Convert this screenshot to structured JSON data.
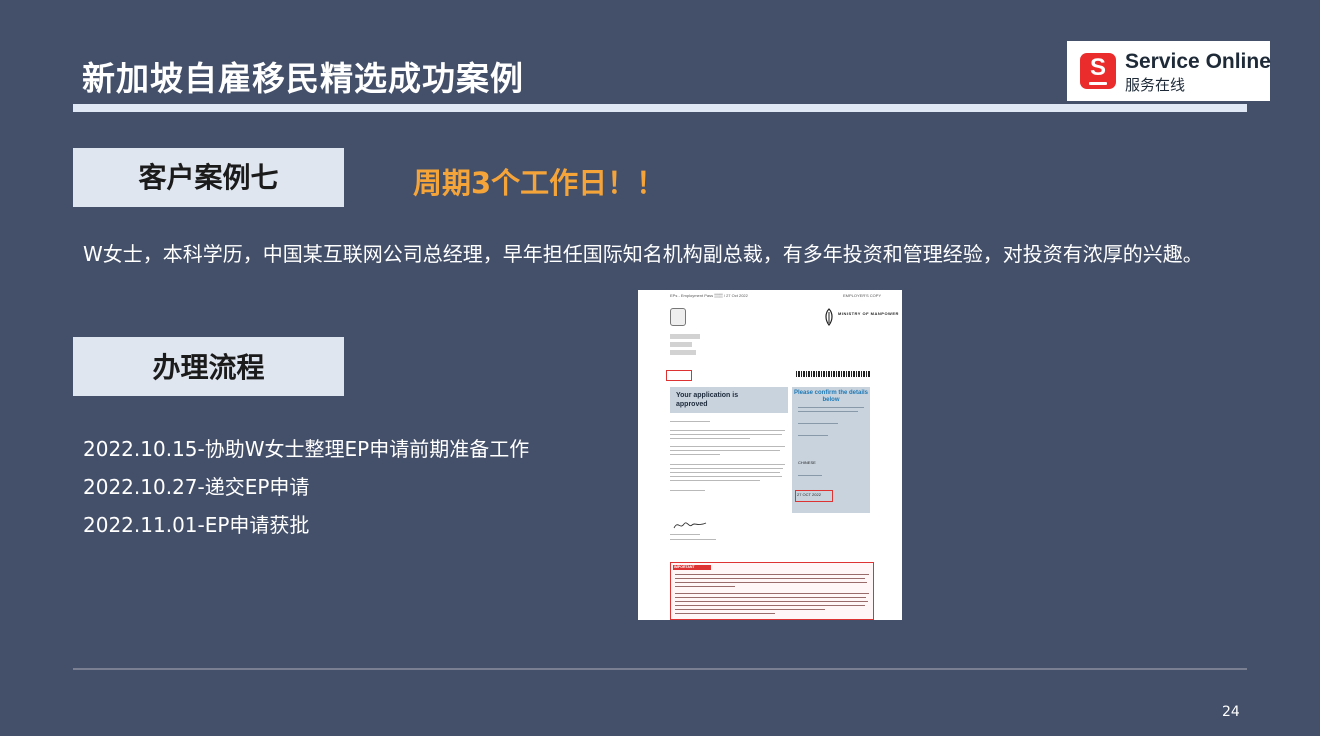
{
  "header": {
    "title": "新加坡自雇移民精选成功案例"
  },
  "logo": {
    "mark": "S",
    "name_en": "Service Online",
    "name_cn": "服务在线",
    "brand_color": "#ea2c2c"
  },
  "case": {
    "label": "客户案例七",
    "period": "周期3个工作日！！",
    "description": "W女士，本科学历，中国某互联网公司总经理，早年担任国际知名机构副总裁，有多年投资和管理经验，对投资有浓厚的兴趣。"
  },
  "process": {
    "label": "办理流程",
    "steps": [
      "2022.10.15-协助W女士整理EP申请前期准备工作",
      "2022.10.27-递交EP申请",
      "2022.11.01-EP申请获批"
    ]
  },
  "document": {
    "approved_title": "Your application is approved",
    "confirm_title": "Please confirm the details below",
    "ministry": "MINISTRY OF MANPOWER",
    "important_label": "IMPORTANT",
    "nationality": "CHINESE",
    "date_value": "27 OCT 2022"
  },
  "footer": {
    "page_number": "24"
  },
  "colors": {
    "background": "#44506a",
    "accent_orange": "#f5a43a",
    "label_box": "#dfe6ef"
  }
}
